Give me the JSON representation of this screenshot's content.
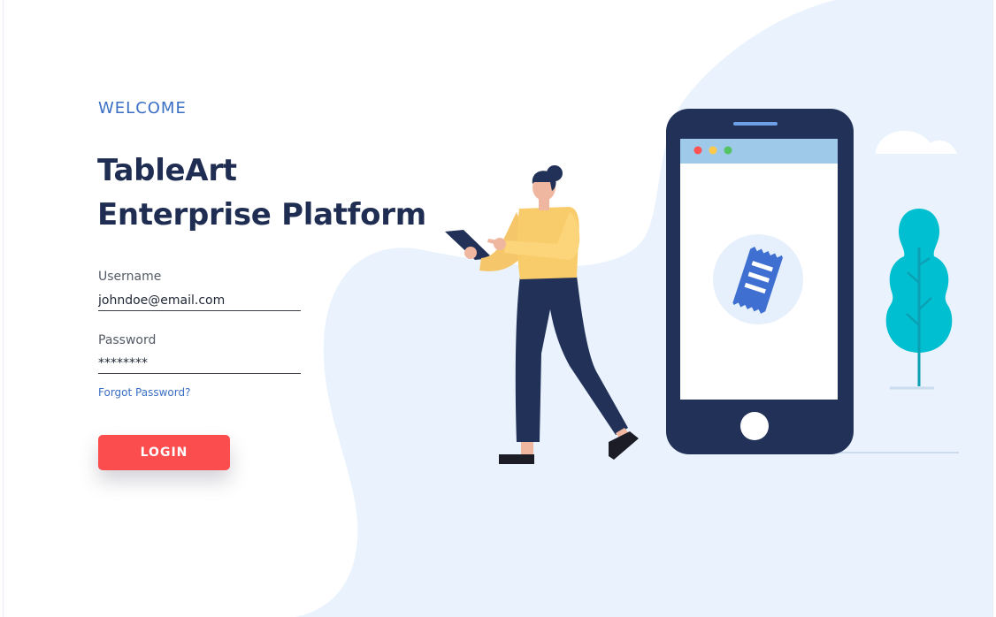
{
  "header": {
    "welcome": "WELCOME",
    "title_line1": "TableArt",
    "title_line2": "Enterprise Platform"
  },
  "form": {
    "username_label": "Username",
    "username_value": "johndoe@email.com",
    "password_label": "Password",
    "password_value": "********",
    "forgot_label": "Forgot Password?",
    "login_label": "LOGIN"
  },
  "colors": {
    "accent": "#3a6fc4",
    "title": "#1f2d52",
    "login_button": "#fb4d4d",
    "background_blob": "#eaf3fd",
    "phone_body": "#223158",
    "tree": "#00bfd0"
  },
  "icons": [
    "receipt-icon",
    "phone-illustration",
    "woman-illustration",
    "tree-illustration",
    "cloud-illustration"
  ]
}
